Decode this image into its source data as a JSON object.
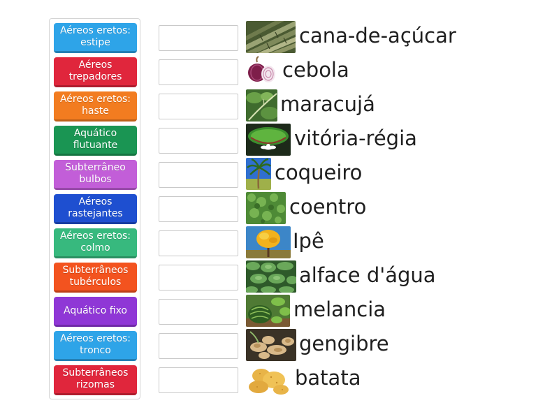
{
  "tiles": [
    {
      "label": "Aéreos eretos: estipe",
      "color": "#2ea4e8"
    },
    {
      "label": "Aéreos trepadores",
      "color": "#e0263c"
    },
    {
      "label": "Aéreos eretos: haste",
      "color": "#f27c20"
    },
    {
      "label": "Aquático flutuante",
      "color": "#1a9553"
    },
    {
      "label": "Subterrâneo bulbos",
      "color": "#c25ed8"
    },
    {
      "label": "Aéreos rastejantes",
      "color": "#1e4fd0"
    },
    {
      "label": "Aéreos eretos: colmo",
      "color": "#37b97e"
    },
    {
      "label": "Subterrâneos tubérculos",
      "color": "#f3531f"
    },
    {
      "label": "Aquático fixo",
      "color": "#8f37d6"
    },
    {
      "label": "Aéreos eretos: tronco",
      "color": "#2ea4e8"
    },
    {
      "label": "Subterrâneos rizomas",
      "color": "#e0263c"
    }
  ],
  "items": [
    {
      "label": "cana-de-açúcar",
      "image": "sugarcane-photo"
    },
    {
      "label": "cebola",
      "image": "red-onion-photo"
    },
    {
      "label": "maracujá",
      "image": "passion-fruit-vine-photo"
    },
    {
      "label": "vitória-régia",
      "image": "water-lily-photo"
    },
    {
      "label": "coqueiro",
      "image": "coconut-palm-photo"
    },
    {
      "label": "coentro",
      "image": "coriander-photo"
    },
    {
      "label": "Ipê",
      "image": "ipe-tree-photo"
    },
    {
      "label": "alface d'água",
      "image": "water-lettuce-photo"
    },
    {
      "label": "melancia",
      "image": "watermelon-photo"
    },
    {
      "label": "gengibre",
      "image": "ginger-photo"
    },
    {
      "label": "batata",
      "image": "potato-photo"
    }
  ]
}
